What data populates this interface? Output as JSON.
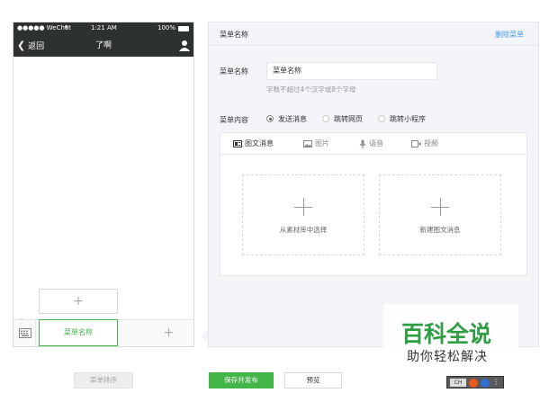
{
  "status_bar": {
    "carrier": "●●●●● WeChat",
    "time": "1:21 AM",
    "battery": "100%"
  },
  "nav_bar": {
    "back_label": "返回",
    "title": "了啊"
  },
  "phone_menu": {
    "sub_add": "+",
    "active_menu": "菜单名称",
    "add": "+"
  },
  "sort_button": "菜单排序",
  "editor": {
    "title": "菜单名称",
    "delete_link": "删除菜单",
    "name_label": "菜单名称",
    "name_value": "菜单名称",
    "hint": "字数不超过4个汉字或8个字母",
    "content_label": "菜单内容",
    "radio_options": [
      "发送消息",
      "跳转网页",
      "跳转小程序"
    ],
    "tabs": [
      "图文消息",
      "图片",
      "语音",
      "视频"
    ],
    "pick_from_library": "从素材库中选择",
    "new_article": "新建图文消息"
  },
  "actions": {
    "save_publish": "保存并发布",
    "preview": "预览"
  },
  "watermark": {
    "title": "百科全说",
    "subtitle": "助你轻松解决"
  },
  "ime_badge": "CH",
  "colors": {
    "accent": "#44b549",
    "header": "#2e3132",
    "link": "#459ae9",
    "watermark": "#2f9d42"
  }
}
